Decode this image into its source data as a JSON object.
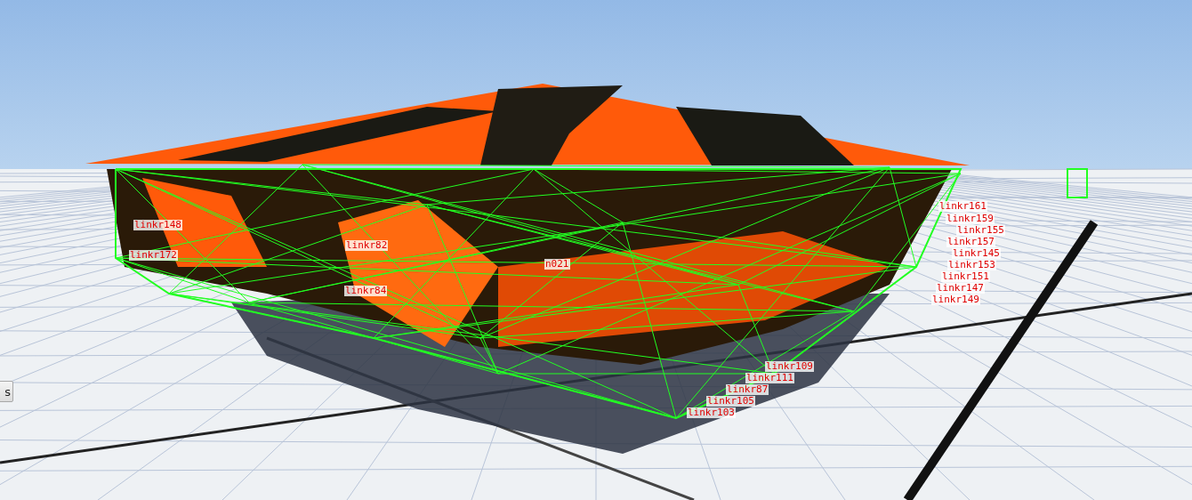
{
  "viewport": {
    "labels": [
      {
        "text": "linkr161"
      },
      {
        "text": "linkr159"
      },
      {
        "text": "linkr155"
      },
      {
        "text": "linkr157"
      },
      {
        "text": "linkr145"
      },
      {
        "text": "linkr153"
      },
      {
        "text": "linkr151"
      },
      {
        "text": "linkr147"
      },
      {
        "text": "linkr149"
      },
      {
        "text": "linkr109"
      },
      {
        "text": "linkr111"
      },
      {
        "text": "linkr87"
      },
      {
        "text": "linkr105"
      },
      {
        "text": "linkr103"
      },
      {
        "text": "linkr84"
      },
      {
        "text": "linkr82"
      },
      {
        "text": "n021"
      },
      {
        "text": "linkr148"
      },
      {
        "text": "linkr172"
      }
    ]
  },
  "side_button": {
    "label": "s"
  }
}
